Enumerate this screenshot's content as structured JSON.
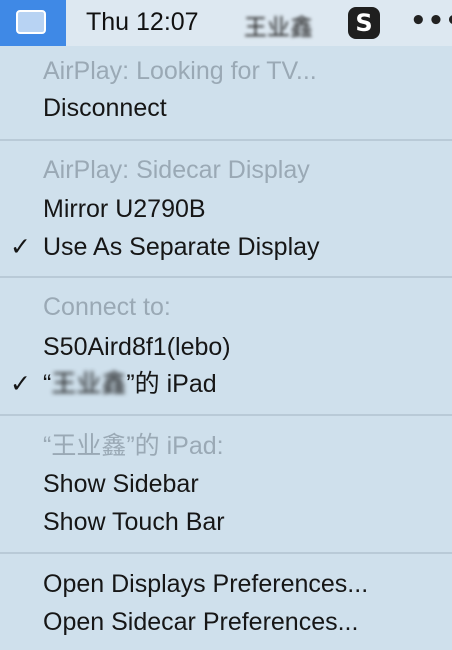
{
  "menubar": {
    "airplay_icon": "airplay-display-icon",
    "clock": "Thu 12:07",
    "user_name": "王业鑫",
    "s_app_label": "S",
    "more_glyph": "•••"
  },
  "menu": {
    "sections": [
      {
        "items": [
          {
            "label": "AirPlay: Looking for TV...",
            "enabled": false
          },
          {
            "label": "Disconnect",
            "enabled": true
          }
        ]
      },
      {
        "items": [
          {
            "label": "AirPlay: Sidecar Display",
            "enabled": false
          },
          {
            "label": "Mirror U2790B",
            "enabled": true
          },
          {
            "label": "Use As Separate Display",
            "enabled": true,
            "checked": true
          }
        ]
      },
      {
        "items": [
          {
            "label": "Connect to:",
            "enabled": false
          },
          {
            "label": "S50Aird8f1(lebo)",
            "enabled": true
          },
          {
            "label_open_quote": "“",
            "label_name": "王业鑫",
            "label_suffix": "”的 iPad",
            "enabled": true,
            "checked": true
          }
        ]
      },
      {
        "items": [
          {
            "label": "“王业鑫”的 iPad:",
            "enabled": false
          },
          {
            "label": "Show Sidebar",
            "enabled": true
          },
          {
            "label": "Show Touch Bar",
            "enabled": true
          }
        ]
      },
      {
        "items": [
          {
            "label": "Open Displays Preferences...",
            "enabled": true
          },
          {
            "label": "Open Sidecar Preferences...",
            "enabled": true
          }
        ]
      }
    ],
    "check_glyph": "✓"
  },
  "colors": {
    "menubar_bg": "#dde8f1",
    "menu_bg": "#cfe0ec",
    "highlight_blue": "#3f89e6",
    "disabled_text": "#9aa9b5",
    "enabled_text": "#161616",
    "separator": "#b9cad7"
  }
}
